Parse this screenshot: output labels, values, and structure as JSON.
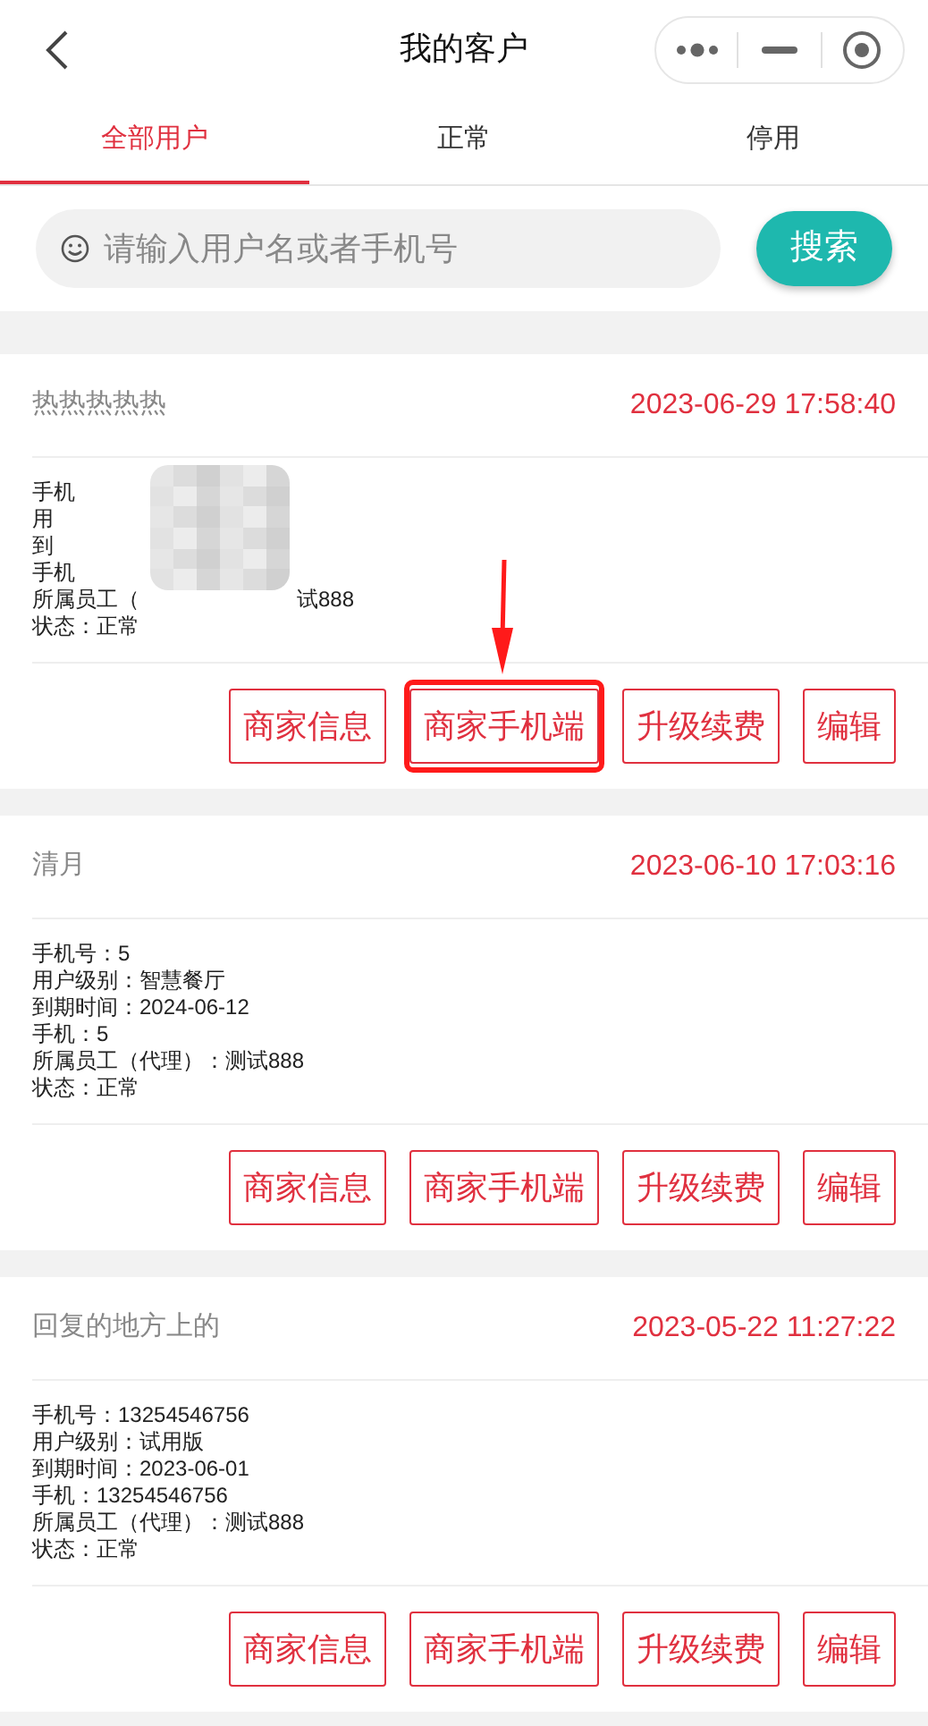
{
  "header": {
    "title": "我的客户"
  },
  "tabs": [
    {
      "label": "全部用户",
      "selected": true
    },
    {
      "label": "正常",
      "selected": false
    },
    {
      "label": "停用",
      "selected": false
    }
  ],
  "search": {
    "placeholder": "请输入用户名或者手机号",
    "button": "搜索"
  },
  "customers": [
    {
      "name": "热热热热热",
      "time": "2023-06-29 17:58:40",
      "blurred": true,
      "details": [
        {
          "text": "手机"
        },
        {
          "text": "用"
        },
        {
          "text": "到"
        },
        {
          "text": "手机"
        },
        {
          "text": "所属员工（",
          "after": "试888"
        },
        {
          "text": "状态：正常"
        }
      ],
      "buttons": [
        {
          "label": "商家信息",
          "annotated": false
        },
        {
          "label": "商家手机端",
          "annotated": true
        },
        {
          "label": "升级续费",
          "annotated": false
        },
        {
          "label": "编辑",
          "annotated": false
        }
      ]
    },
    {
      "name": "清月",
      "time": "2023-06-10 17:03:16",
      "blurred": false,
      "details": [
        {
          "text": "手机号：5"
        },
        {
          "text": "用户级别：智慧餐厅"
        },
        {
          "text": "到期时间：2024-06-12"
        },
        {
          "text": "手机：5"
        },
        {
          "text": "所属员工（代理）：测试888"
        },
        {
          "text": "状态：正常"
        }
      ],
      "buttons": [
        {
          "label": "商家信息",
          "annotated": false
        },
        {
          "label": "商家手机端",
          "annotated": false
        },
        {
          "label": "升级续费",
          "annotated": false
        },
        {
          "label": "编辑",
          "annotated": false
        }
      ]
    },
    {
      "name": "回复的地方上的",
      "time": "2023-05-22 11:27:22",
      "blurred": false,
      "details": [
        {
          "text": "手机号：13254546756"
        },
        {
          "text": "用户级别：试用版"
        },
        {
          "text": "到期时间：2023-06-01"
        },
        {
          "text": "手机：13254546756"
        },
        {
          "text": "所属员工（代理）：测试888"
        },
        {
          "text": "状态：正常"
        }
      ],
      "buttons": [
        {
          "label": "商家信息",
          "annotated": false
        },
        {
          "label": "商家手机端",
          "annotated": false
        },
        {
          "label": "升级续费",
          "annotated": false
        },
        {
          "label": "编辑",
          "annotated": false
        }
      ]
    }
  ]
}
